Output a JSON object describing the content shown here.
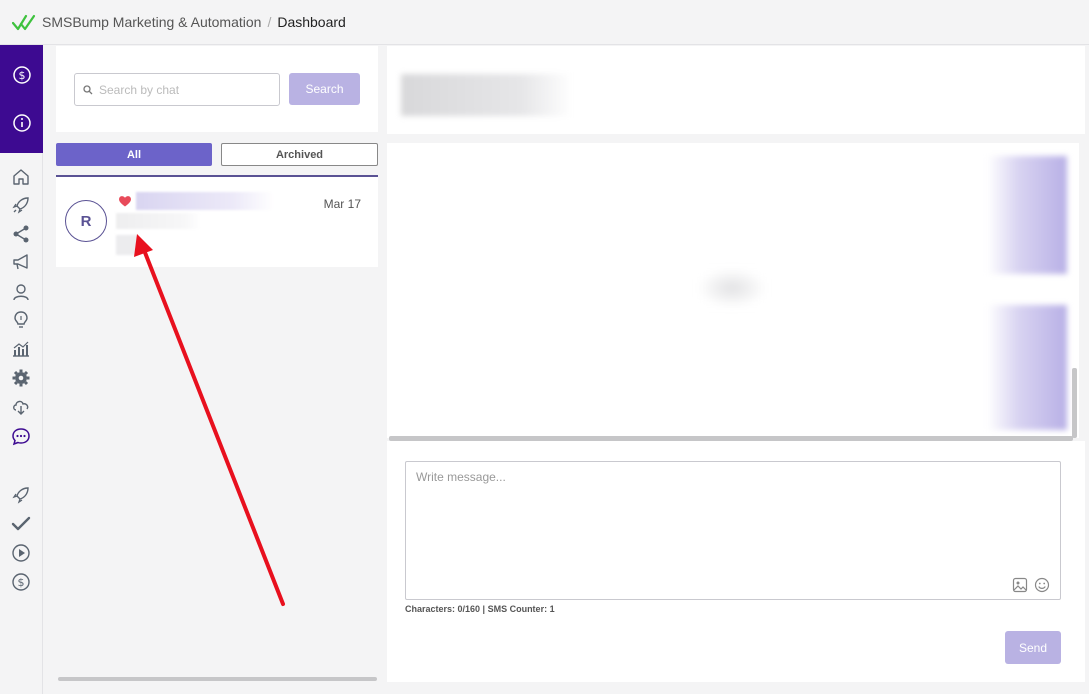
{
  "header": {
    "app_name": "SMSBump Marketing & Automation",
    "separator": "/",
    "page": "Dashboard"
  },
  "rail": {
    "top_icons": [
      "dollar-icon",
      "info-icon"
    ],
    "icons": [
      "home-icon",
      "rocket-icon",
      "share-icon",
      "megaphone-icon",
      "user-icon",
      "lightbulb-icon",
      "chart-icon",
      "gear-icon",
      "cloud-icon",
      "chat-icon",
      "rocket-outline-icon",
      "check-icon",
      "play-icon",
      "dollar-circle-icon"
    ]
  },
  "search": {
    "placeholder": "Search by chat",
    "button_label": "Search"
  },
  "tabs": {
    "all": "All",
    "archived": "Archived"
  },
  "chat_list": [
    {
      "avatar_letter": "R",
      "date": "Mar 17",
      "favorite": true
    }
  ],
  "compose": {
    "placeholder": "Write message...",
    "counter": "Characters: 0/160 | SMS Counter: 1",
    "send_label": "Send"
  },
  "colors": {
    "brand_dark": "#3d0a91",
    "accent": "#6c63c9",
    "button_disabled": "#b9b2e3",
    "heart": "#e84a5a",
    "arrow": "#e8101e"
  }
}
